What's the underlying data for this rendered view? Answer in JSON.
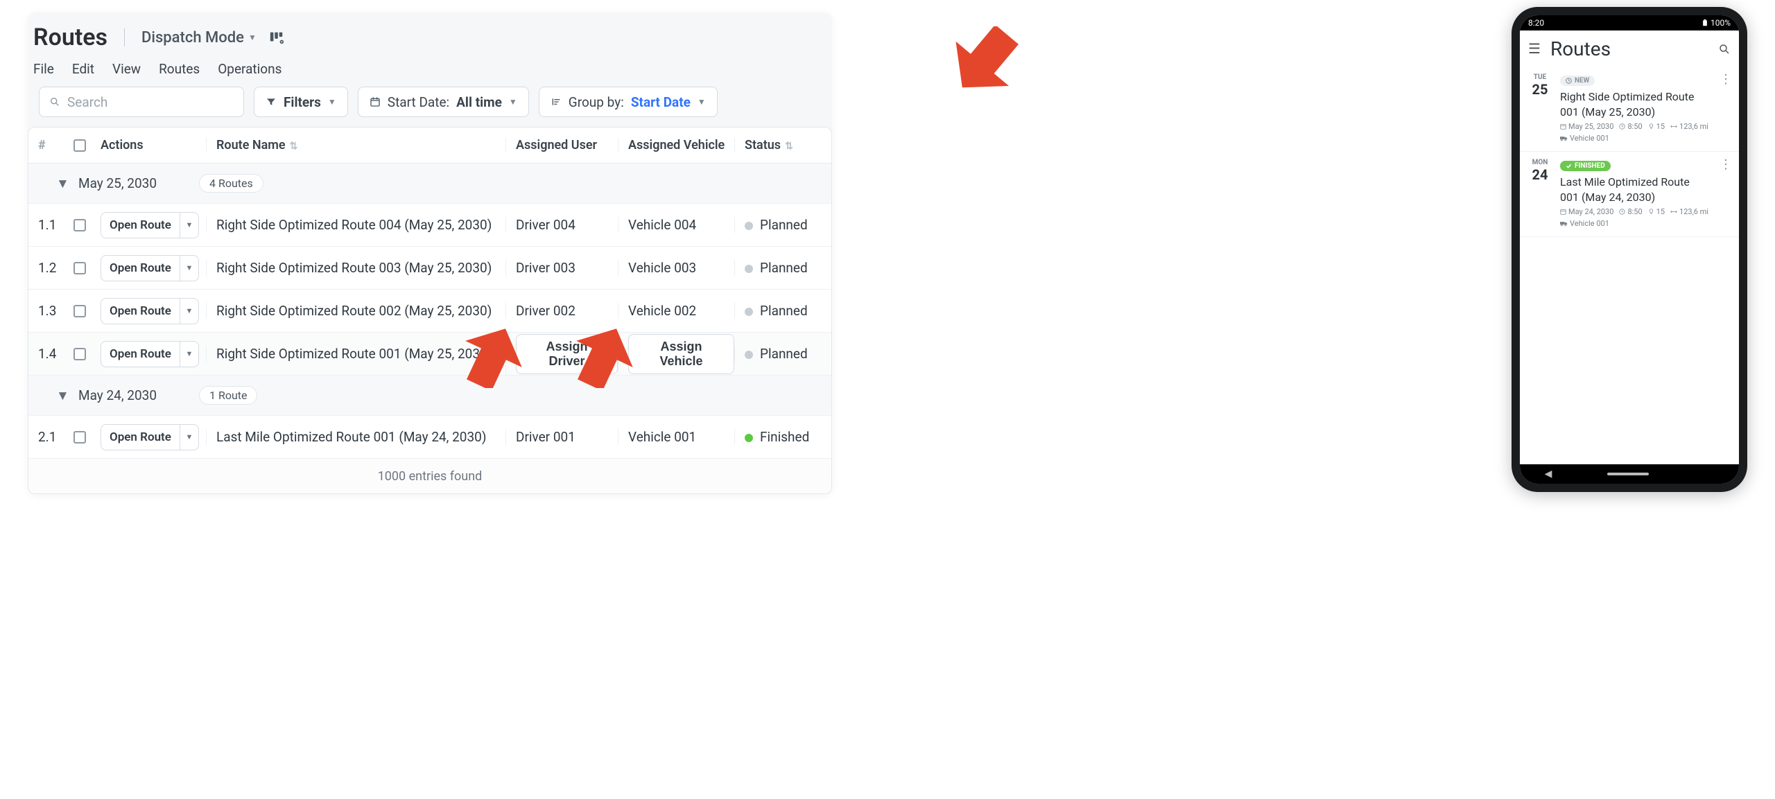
{
  "header": {
    "title": "Routes",
    "mode_label": "Dispatch Mode"
  },
  "menu": {
    "file": "File",
    "edit": "Edit",
    "view": "View",
    "routes": "Routes",
    "operations": "Operations"
  },
  "toolbar": {
    "search_placeholder": "Search",
    "filters_label": "Filters",
    "date_label": "Start Date:",
    "date_value": "All time",
    "group_label": "Group by:",
    "group_value": "Start Date"
  },
  "columns": {
    "idx": "#",
    "actions": "Actions",
    "route_name": "Route Name",
    "assigned_user": "Assigned User",
    "assigned_vehicle": "Assigned Vehicle",
    "status": "Status"
  },
  "buttons": {
    "open_route": "Open Route",
    "assign_driver": "Assign Driver",
    "assign_vehicle": "Assign Vehicle"
  },
  "status": {
    "planned": "Planned",
    "finished": "Finished"
  },
  "groups": [
    {
      "date": "May 25, 2030",
      "count_label": "4 Routes",
      "rows": [
        {
          "idx": "1.1",
          "name": "Right Side Optimized Route 004 (May 25, 2030)",
          "user": "Driver 004",
          "veh": "Vehicle 004",
          "status": "planned",
          "assign": false
        },
        {
          "idx": "1.2",
          "name": "Right Side Optimized Route 003 (May 25, 2030)",
          "user": "Driver 003",
          "veh": "Vehicle 003",
          "status": "planned",
          "assign": false
        },
        {
          "idx": "1.3",
          "name": "Right Side Optimized Route 002 (May 25, 2030)",
          "user": "Driver 002",
          "veh": "Vehicle 002",
          "status": "planned",
          "assign": false
        },
        {
          "idx": "1.4",
          "name": "Right Side Optimized Route 001 (May 25, 2030)",
          "user": "",
          "veh": "",
          "status": "planned",
          "assign": true
        }
      ]
    },
    {
      "date": "May 24, 2030",
      "count_label": "1 Route",
      "rows": [
        {
          "idx": "2.1",
          "name": "Last Mile Optimized Route 001 (May 24, 2030)",
          "user": "Driver 001",
          "veh": "Vehicle 001",
          "status": "finished",
          "assign": false
        }
      ]
    }
  ],
  "footer": {
    "entries": "1000 entries found"
  },
  "phone": {
    "status": {
      "time": "8:20",
      "battery": "100%"
    },
    "title": "Routes",
    "items": [
      {
        "dow": "TUE",
        "day": "25",
        "badge": "NEW",
        "badge_kind": "new",
        "name": "Right Side Optimized Route 001 (May 25, 2030)",
        "date": "May 25, 2030",
        "time": "8:50",
        "stops": "15",
        "dist": "123,6 mi",
        "veh": "Vehicle 001"
      },
      {
        "dow": "MON",
        "day": "24",
        "badge": "FINISHED",
        "badge_kind": "fin",
        "name": "Last Mile Optimized Route 001 (May 24, 2030)",
        "date": "May 24, 2030",
        "time": "8:50",
        "stops": "15",
        "dist": "123,6 mi",
        "veh": "Vehicle 001"
      }
    ]
  }
}
